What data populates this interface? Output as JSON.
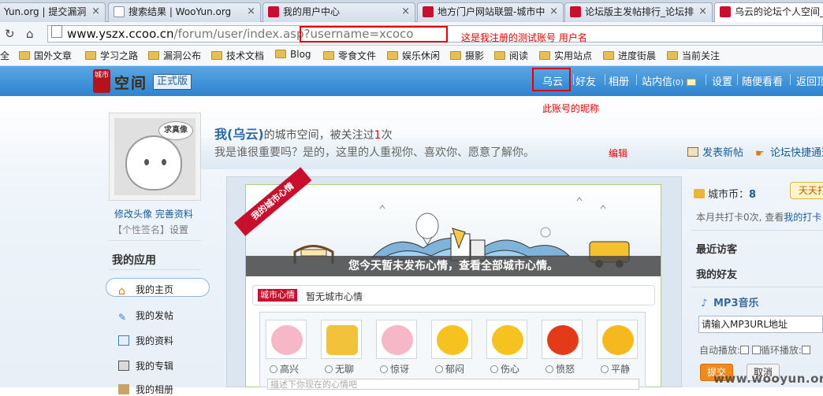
{
  "browser": {
    "tabs": [
      {
        "label": "Yun.org | 提交漏洞",
        "icon": "page-icon"
      },
      {
        "label": "搜索结果 | WooYun.org",
        "icon": "page-icon"
      },
      {
        "label": "我的用户中心",
        "icon": "ccoo-icon"
      },
      {
        "label": "地方门户网站联盟-城市中",
        "icon": "ccoo-icon"
      },
      {
        "label": "论坛版主发帖排行_论坛排",
        "icon": "ccoo-icon"
      },
      {
        "label": "乌云的论坛个人空间_",
        "icon": "ccoo-icon"
      }
    ],
    "url_host": "www.yszx.ccoo.cn",
    "url_path": "/forum/user/index.asp",
    "url_query": "?username=xcoco",
    "bookmarks": [
      "全",
      "国外文章",
      "学习之路",
      "漏洞公布",
      "技术文档",
      "Blog",
      "零食文件",
      "娱乐休闲",
      "摄影",
      "阅读",
      "实用站点",
      "进度街晨",
      "当前关注"
    ]
  },
  "annotations": {
    "url_note": "这是我注册的测试账号  用户名",
    "nick_note": "此账号的昵称"
  },
  "site": {
    "logo_seal": "城市",
    "logo_text": "空间",
    "logo_badge": "正式版",
    "nav": [
      "乌云",
      "好友",
      "相册",
      "站内信",
      "设置",
      "随便看看",
      "返回顶"
    ],
    "mail_count": "(0)"
  },
  "profile": {
    "avatar_bubble": "求真像",
    "edit_avatar": "修改头像",
    "edit_info": "完善资料",
    "signature": "【个性签名】",
    "signature_setting": "设置",
    "title_me": "我",
    "title_nick": "(乌云)",
    "title_suffix": "的城市空间，被关注过",
    "title_count": "1",
    "title_unit": "次",
    "subtitle": "我是谁很重要吗？是的，这里的人重视你、喜欢你、愿意了解你。",
    "edit": "编辑",
    "post_new": "发表新帖",
    "forum_shortcut": "论坛快捷通道"
  },
  "apps": {
    "title": "我的应用",
    "items": [
      "我的主页",
      "我的发帖",
      "我的资料",
      "我的专辑",
      "我的相册"
    ]
  },
  "mood": {
    "ribbon": "我的城市心情",
    "banner_text": "您今天暂未发布心情，查看全部城市心情。",
    "tag": "城市心情",
    "empty": "暂无城市心情",
    "emotions": [
      "高兴",
      "无聊",
      "惊讶",
      "郁闷",
      "伤心",
      "愤怒",
      "平静"
    ],
    "textarea_placeholder": "描述下你现在的心情吧"
  },
  "right": {
    "coins_label": "城市币：",
    "coins_value": "8",
    "sign_button": "天天打",
    "checkin_prefix": "本月共打卡",
    "checkin_count": "0",
    "checkin_suffix": "次, 查看",
    "checkin_link": "我的打卡",
    "recent_visitors": "最近访客",
    "my_friends": "我的好友",
    "mp3_title": "MP3音乐",
    "mp3_placeholder": "请输入MP3URL地址",
    "autoplay": "自动播放:",
    "loop": "循环播放:",
    "submit": "提交",
    "cancel": "取消"
  },
  "watermark": "www.wooyun.org"
}
